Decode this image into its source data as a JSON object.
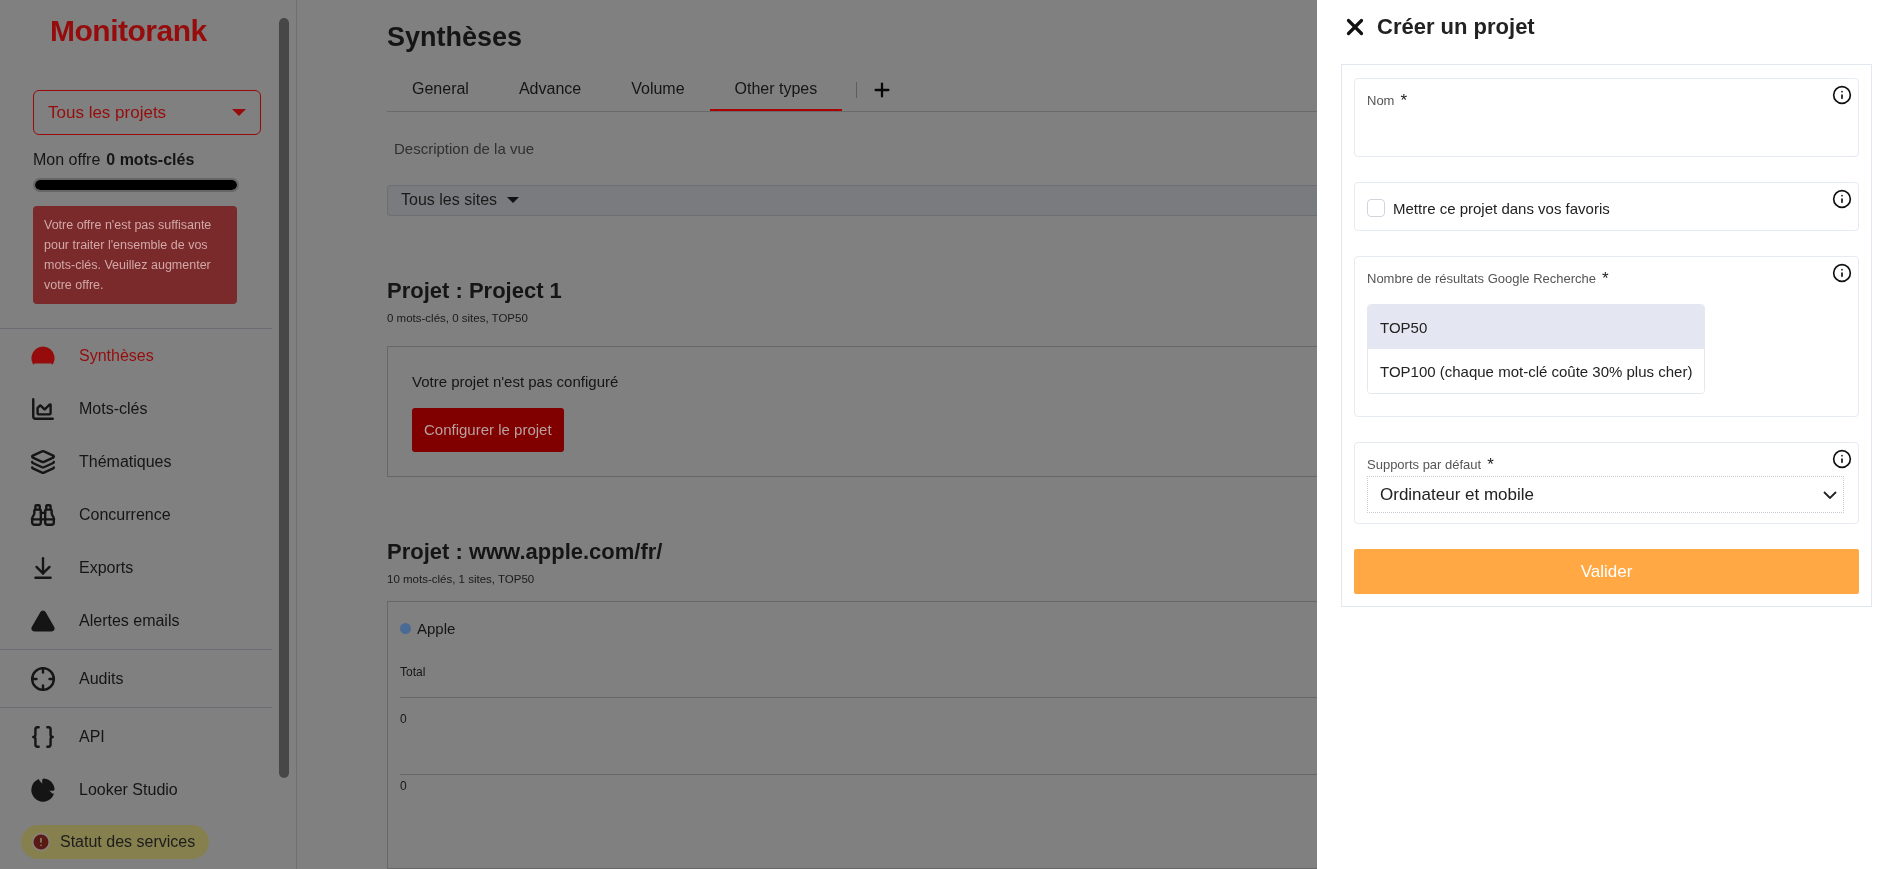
{
  "sidebar": {
    "logo": "Monitorank",
    "project_select": "Tous les projets",
    "plan": {
      "label": "Mon offre",
      "value": "0 mots-clés",
      "level": 1
    },
    "alert": "Votre offre n'est pas suffisante pour traiter l'ensemble de vos mots-clés. Veuillez augmenter votre offre.",
    "nav_groups": [
      [
        {
          "label": "Synthèses",
          "selected": true
        },
        {
          "label": "Mots-clés",
          "selected": false
        },
        {
          "label": "Thématiques",
          "selected": false
        },
        {
          "label": "Concurrence",
          "selected": false
        },
        {
          "label": "Exports",
          "selected": false
        },
        {
          "label": "Alertes emails",
          "selected": false
        }
      ],
      [
        {
          "label": "Audits",
          "selected": false
        }
      ],
      [
        {
          "label": "API",
          "selected": false
        },
        {
          "label": "Looker Studio",
          "selected": false
        }
      ]
    ],
    "status_button": "Statut des services"
  },
  "main": {
    "title": "Synthèses",
    "tabs": [
      {
        "label": "General",
        "selected": false
      },
      {
        "label": "Advance",
        "selected": false
      },
      {
        "label": "Volume",
        "selected": false
      },
      {
        "label": "Other types",
        "selected": true
      }
    ],
    "description": "Description de la vue",
    "site_filter": "Tous les sites",
    "projects": [
      {
        "kind": "unconfigured",
        "title": "Projet : Project 1",
        "meta": "0 mots-clés, 0 sites, TOP50",
        "message": "Votre projet n'est pas configuré",
        "button": "Configurer le projet"
      },
      {
        "kind": "chart",
        "title": "Projet : www.apple.com/fr/",
        "meta": "10 mots-clés, 1 sites, TOP50",
        "legend": [
          {
            "label": "Apple",
            "color": "#4a6a96"
          }
        ],
        "rows": [
          "Total",
          "0",
          "0"
        ]
      }
    ]
  },
  "drawer": {
    "title": "Créer un projet",
    "fields": [
      {
        "kind": "text",
        "label": "Nom",
        "required_mark": "*"
      },
      {
        "kind": "checkbox",
        "label": "Mettre ce projet dans vos favoris",
        "checked": false
      },
      {
        "kind": "options",
        "label": "Nombre de résultats Google Recherche",
        "required_mark": "*",
        "options": [
          {
            "label": "TOP50",
            "selected": true
          },
          {
            "label": "TOP100 (chaque mot-clé coûte 30% plus cher)",
            "selected": false
          }
        ]
      },
      {
        "kind": "select",
        "label": "Supports par défaut",
        "required_mark": "*",
        "value": "Ordinateur et mobile"
      }
    ],
    "submit": "Valider"
  }
}
